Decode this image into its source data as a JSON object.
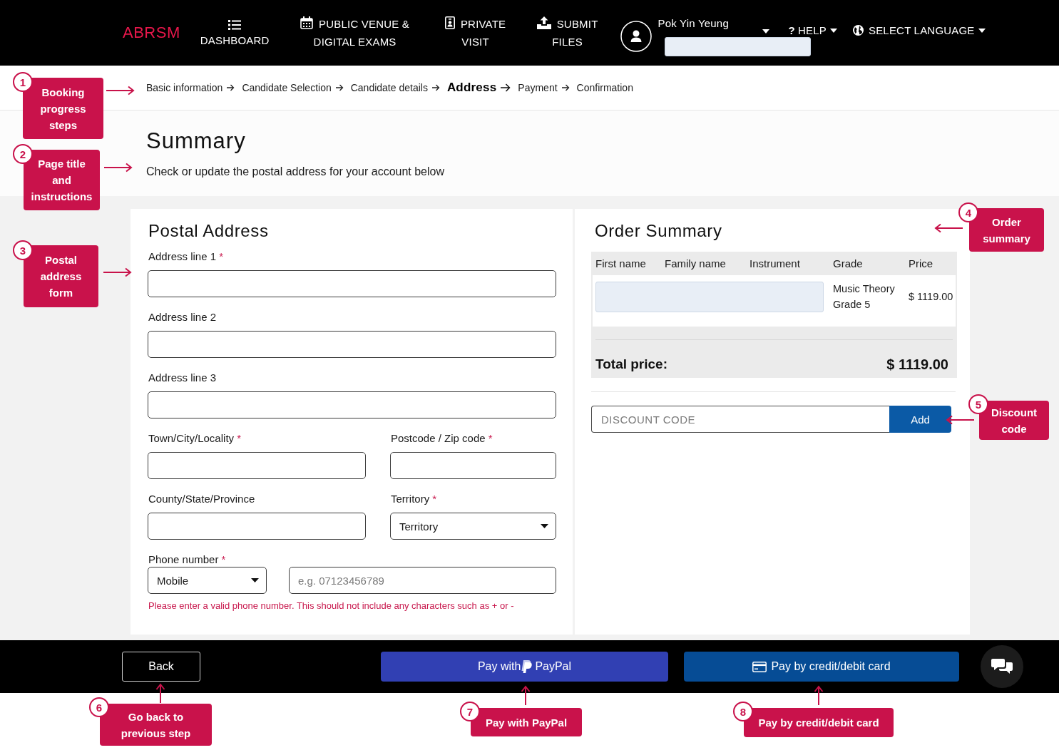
{
  "top_nav": {
    "logo": "ABRSM",
    "links": [
      {
        "kind": "stacked",
        "label": "DASHBOARD"
      },
      {
        "kind": "inline",
        "label": "PUBLIC VENUE & DIGITAL EXAMS"
      },
      {
        "kind": "inline",
        "label": "PRIVATE VISIT"
      },
      {
        "kind": "inline",
        "label": "SUBMIT FILES"
      }
    ],
    "user": {
      "name": "Pok Yin Yeung",
      "detail_redacted": true
    },
    "help": {
      "symbol": "?",
      "label": "HELP"
    },
    "language": {
      "label": "SELECT LANGUAGE"
    }
  },
  "breadcrumb": {
    "steps": [
      {
        "label": "Basic information",
        "selected": false
      },
      {
        "label": "Candidate Selection",
        "selected": false
      },
      {
        "label": "Candidate details",
        "selected": false
      },
      {
        "label": "Address",
        "selected": true
      },
      {
        "label": "Payment",
        "selected": false
      },
      {
        "label": "Confirmation",
        "selected": false
      }
    ]
  },
  "page_header": {
    "title": "Summary",
    "instructions": "Check or update the postal address for your account below"
  },
  "postal_address": {
    "title": "Postal Address",
    "required_mark": "*",
    "rows": [
      {
        "fields": [
          {
            "kind": "text",
            "label": "Address line 1",
            "required": true
          }
        ]
      },
      {
        "fields": [
          {
            "kind": "text",
            "label": "Address line 2",
            "required": false
          }
        ]
      },
      {
        "fields": [
          {
            "kind": "text",
            "label": "Address line 3",
            "required": false
          }
        ]
      },
      {
        "fields": [
          {
            "kind": "text",
            "label": "Town/City/Locality",
            "required": true
          },
          {
            "kind": "text",
            "label": "Postcode / Zip code",
            "required": true
          }
        ]
      },
      {
        "fields": [
          {
            "kind": "text",
            "label": "County/State/Province",
            "required": false
          },
          {
            "kind": "select",
            "label": "Territory",
            "required": true,
            "value": "Territory"
          }
        ]
      }
    ],
    "phone": {
      "label": "Phone number",
      "required": true,
      "type_value": "Mobile",
      "placeholder": "e.g. 07123456789",
      "error": "Please enter a valid phone number. This should not include any characters such as + or -"
    }
  },
  "order_summary": {
    "title": "Order Summary",
    "columns": [
      "First name",
      "Family name",
      "Instrument",
      "Grade",
      "Price"
    ],
    "rows": [
      {
        "redacted": true,
        "cells": [
          "",
          "",
          "",
          "Music Theory Grade 5",
          "$ 1119.00"
        ]
      }
    ],
    "total_label": "Total price:",
    "total_value": "$ 1119.00",
    "discount": {
      "placeholder": "DISCOUNT CODE",
      "button": "Add"
    }
  },
  "footer": {
    "back_button": "Back",
    "paypal_button": {
      "label": "Pay with",
      "brand": "PayPal"
    },
    "card_button": "Pay by credit/debit card"
  },
  "annotations": [
    {
      "number": "1",
      "text": "Booking progress steps",
      "kind": "rightward"
    },
    {
      "number": "2",
      "text": "Page title and instructions",
      "kind": "rightward"
    },
    {
      "number": "3",
      "text": "Postal address form",
      "kind": "rightward"
    },
    {
      "number": "4",
      "text": "Order summary",
      "kind": "leftward"
    },
    {
      "number": "5",
      "text": "Discount code",
      "kind": "leftward"
    },
    {
      "number": "6",
      "text": "Go back to previous step",
      "kind": "upward"
    },
    {
      "number": "7",
      "text": "Pay with PayPal",
      "kind": "upward"
    },
    {
      "number": "8",
      "text": "Pay by credit/debit card",
      "kind": "upward"
    }
  ]
}
